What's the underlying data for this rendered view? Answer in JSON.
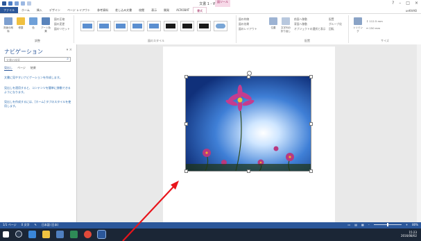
{
  "window": {
    "title": "文書 1 - Word",
    "tool_tag": "図ツール",
    "user": "ueKHAB"
  },
  "ribbon_tabs": [
    "ファイル",
    "ホーム",
    "挿入",
    "デザイン",
    "ページ レイアウト",
    "参考資料",
    "差し込み文書",
    "校閲",
    "表示",
    "開発",
    "ACROBAT",
    "書式"
  ],
  "ribbon": {
    "adjust": {
      "buttons": [
        "背景の削除",
        "修整",
        "色",
        "アート効果"
      ],
      "small": [
        "図の圧縮",
        "図の変更",
        "図のリセット"
      ],
      "label": "調整"
    },
    "styles": {
      "label": "図のスタイル"
    },
    "style_side": [
      "図の枠線",
      "図の効果",
      "図のレイアウト"
    ],
    "arrange": {
      "buttons": [
        "位置",
        "文字列の折り返し"
      ],
      "small": [
        "前面へ移動",
        "背面へ移動",
        "オブジェクトの選択と表示",
        "配置",
        "グループ化",
        "回転"
      ],
      "label": "配置"
    },
    "size": {
      "crop": "トリミング",
      "height": "112.5 mm",
      "width": "150 mm",
      "label": "サイズ"
    }
  },
  "nav": {
    "title": "ナビゲーション",
    "search_placeholder": "文書の検索",
    "tabs": [
      "見出し",
      "ページ",
      "結果"
    ],
    "p1": "文書に見やすいナビゲーションを作成します。",
    "p2": "見出しを適用すると、コンテンツを簡単に移動できるようになります。",
    "p3": "見出しを作成するには、[ホーム] タブのスタイルを使用します。"
  },
  "status": {
    "page": "1/1 ページ",
    "words": "0 文字",
    "lang": "日本語 (日本)",
    "zoom": "80%"
  },
  "tray": {
    "time": "15:23",
    "date": "2016/08/02"
  },
  "colors": {
    "accent": "#2b579a",
    "tool": "#a0275f",
    "arrow": "#e8141b"
  }
}
